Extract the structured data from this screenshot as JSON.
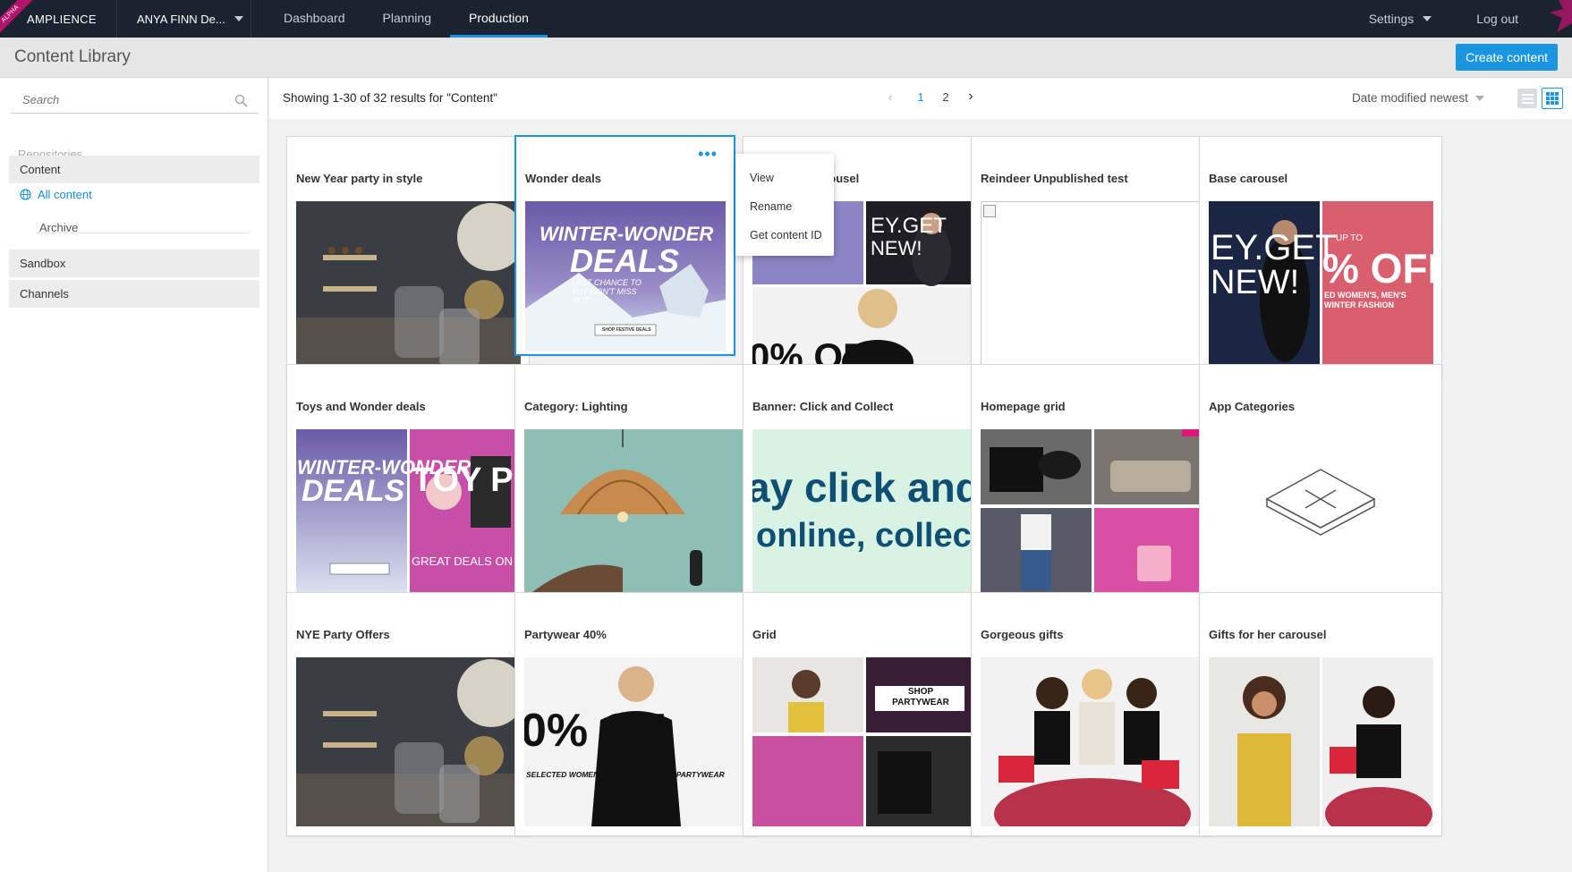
{
  "topbar": {
    "brand": "AMPLIENCE",
    "alpha": "ALPHA",
    "account": "ANYA FINN De...",
    "tabs": [
      "Dashboard",
      "Planning",
      "Production"
    ],
    "active_tab": "Production",
    "settings": "Settings",
    "logout": "Log out"
  },
  "header": {
    "title": "Content Library",
    "create_button": "Create content"
  },
  "sidebar": {
    "search_placeholder": "Search",
    "repositories_label": "Repositories",
    "sections": [
      "Content",
      "Sandbox",
      "Channels"
    ],
    "content_items": [
      "All content",
      "Archive"
    ]
  },
  "toolbar": {
    "results_text": "Showing 1-30 of 32 results for \"Content\"",
    "pages": [
      "1",
      "2"
    ],
    "current_page": "1",
    "sort": "Date modified newest"
  },
  "context_menu": {
    "items": [
      "View",
      "Rename",
      "Get content ID"
    ]
  },
  "cards": [
    {
      "title": "New Year party in style"
    },
    {
      "title": "Wonder deals"
    },
    {
      "title": "Partywear carousel"
    },
    {
      "title": "Reindeer Unpublished test"
    },
    {
      "title": "Base carousel"
    },
    {
      "title": "Toys and Wonder deals"
    },
    {
      "title": "Category: Lighting"
    },
    {
      "title": "Banner: Click and Collect"
    },
    {
      "title": "Homepage grid"
    },
    {
      "title": "App Categories"
    },
    {
      "title": "NYE Party Offers"
    },
    {
      "title": "Partywear 40%"
    },
    {
      "title": "Grid"
    },
    {
      "title": "Gorgeous gifts"
    },
    {
      "title": "Gifts for her carousel"
    }
  ],
  "image_text": {
    "winter": "WINTER-WONDER",
    "deals": "DEALS",
    "last_chance": "LAST CHANCE TO BUY DON'T MISS OUT!",
    "shop_festive": "SHOP FESTIVE DEALS",
    "click_line1": "ay click and",
    "click_line2": "online, collect",
    "toy": "TOY P",
    "great_deals": "GREAT DEALS ON T",
    "off_text": "0% OF",
    "selected_women": "SELECTED WOMEN'S, MEN'S AND KIDS' PARTYWEAR",
    "shop_partywear": "SHOP PARTYWEAR",
    "ey_get": "EY.GET",
    "new": "NEW!",
    "pct_off": "% OFF",
    "up_to": "UP TO",
    "winter_fashion": "ED WOMEN'S, MEN'S WINTER FASHION"
  },
  "colors": {
    "accent": "#1a96e0",
    "topbar": "#1b2330",
    "brand_pink": "#b5146b"
  }
}
